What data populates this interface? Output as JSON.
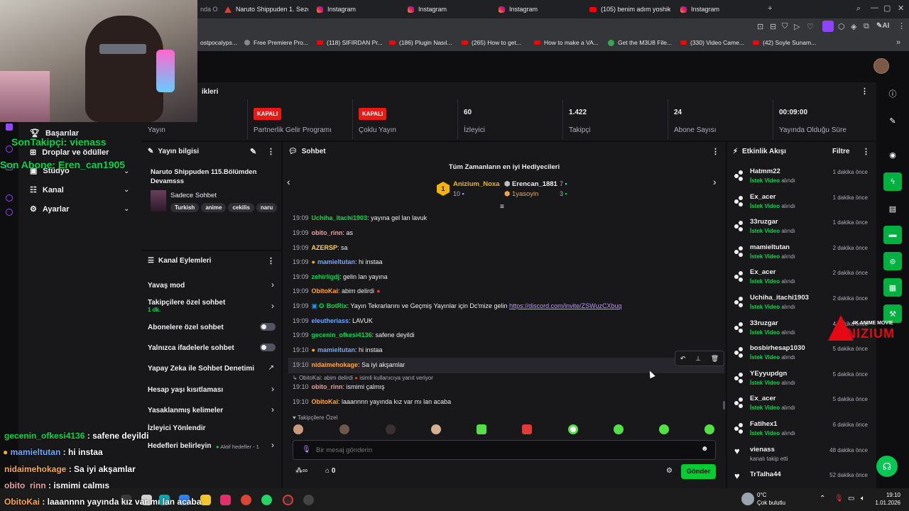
{
  "browser": {
    "tabs": [
      {
        "label": "Naruto Shippuden 1. Sezo",
        "icon": "naruto-icon"
      },
      {
        "label": "Instagram",
        "icon": "instagram-icon"
      },
      {
        "label": "Instagram",
        "icon": "instagram-icon"
      },
      {
        "label": "Instagram",
        "icon": "instagram-icon"
      },
      {
        "label": "(105) benim adım yoshikag",
        "icon": "youtube-icon"
      },
      {
        "label": "Instagram",
        "icon": "instagram-icon"
      }
    ],
    "partial_tab_label": "nda O",
    "bookmarks": [
      "ostpocalyps...",
      "Free Premiere Pro...",
      "(118) SIFIRDAN Pr...",
      "(186) Plugin Nasıl...",
      "(265) How to get...",
      "How to make a VA...",
      "Get the M3U8 File...",
      "(330) Video Came...",
      "(42) Soyle Sunam..."
    ],
    "ai_label": "AI"
  },
  "dashboard": {
    "section_title": "ikleri",
    "stats": [
      {
        "value": "",
        "label": "Yayın",
        "badge": ""
      },
      {
        "value": "",
        "label": "Partnerlik Gelir Programı",
        "badge": "KAPALI"
      },
      {
        "value": "",
        "label": "Çoklu Yayın",
        "badge": "KAPALI"
      },
      {
        "value": "60",
        "label": "İzleyici",
        "badge": ""
      },
      {
        "value": "1.422",
        "label": "Takipçi",
        "badge": ""
      },
      {
        "value": "24",
        "label": "Abone Sayısı",
        "badge": ""
      },
      {
        "value": "00:09:00",
        "label": "Yayında Olduğu Süre",
        "badge": ""
      }
    ]
  },
  "leftnav": {
    "items": [
      {
        "label": "Başarılar",
        "icon": "trophy-icon"
      },
      {
        "label": "Droplar ve ödüller",
        "icon": "gift-icon"
      },
      {
        "label": "Stüdyo",
        "icon": "studio-icon"
      },
      {
        "label": "Kanal",
        "icon": "channel-icon"
      },
      {
        "label": "Ayarlar",
        "icon": "gear-icon"
      }
    ]
  },
  "stream_info": {
    "title": "Yayın bilgisi",
    "stream_title": "Naruto Shippuden 115.Bölümden Devamsss",
    "category": "Sadece Sohbet",
    "tags": [
      "Turkish",
      "anime",
      "cekilis",
      "naru"
    ]
  },
  "channel_actions": {
    "title": "Kanal Eylemleri",
    "items": [
      {
        "label": "Yavaş mod",
        "sub": "",
        "control": "arrow"
      },
      {
        "label": "Takipçilere özel sohbet",
        "sub": "1 dk.",
        "control": "arrow"
      },
      {
        "label": "Abonelere özel sohbet",
        "sub": "",
        "control": "toggle"
      },
      {
        "label": "Yalnızca ifadelerle sohbet",
        "sub": "",
        "control": "toggle"
      },
      {
        "label": "Yapay Zeka ile Sohbet Denetimi",
        "sub": "",
        "control": "external"
      },
      {
        "label": "Hesap yaşı kısıtlaması",
        "sub": "",
        "control": "arrow"
      },
      {
        "label": "Yasaklanmış kelimeler",
        "sub": "",
        "control": "arrow"
      },
      {
        "label": "İzleyici Yönlendir",
        "sub": "",
        "control": "none"
      },
      {
        "label": "Hedefleri belirleyin",
        "sub": "",
        "control": "arrow"
      }
    ],
    "goals_status": "Aktif hedefler - 1"
  },
  "chat": {
    "title": "Sohbet",
    "leaderboard": {
      "title": "Tüm Zamanların en iyi Hediyecileri",
      "first": {
        "name": "Anizium_Noxa",
        "value": "10"
      },
      "second": {
        "name": "Erencan_1881",
        "value": "7"
      },
      "third": {
        "name": "1yasoyin",
        "value": "3"
      }
    },
    "messages": [
      {
        "time": "19:09",
        "user": "Uchiha_itachi1903",
        "color": "#00d94a",
        "text": ": yayına gel lan lavuk"
      },
      {
        "time": "19:09",
        "user": "obito_rinn",
        "color": "#e8a0a0",
        "text": ": as"
      },
      {
        "time": "19:09",
        "user": "AZERSP",
        "color": "#ffce5c",
        "text": ": sa"
      },
      {
        "time": "19:09",
        "user": "mamieltutan",
        "color": "#6fa8ff",
        "text": ": hi instaa"
      },
      {
        "time": "19:09",
        "user": "zehirligdj",
        "color": "#00d94a",
        "text": ": gelin lan yayına"
      },
      {
        "time": "19:09",
        "user": "ObitoKai",
        "color": "#ffa640",
        "text": ": abim delirdi"
      },
      {
        "time": "19:09",
        "user": "BotRix",
        "color": "#00d94a",
        "text": ": Yayın Tekrarlarını ve Geçmiş Yayınlar için Dc'mize gelin ",
        "link": "https://discord.com/invite/ZSWuzCXbuq"
      },
      {
        "time": "19:09",
        "user": "eleutheriass",
        "color": "#6fa8ff",
        "text": ": LAVUK"
      },
      {
        "time": "19:09",
        "user": "gecenin_ofkesi4136",
        "color": "#00d94a",
        "text": ": safene deyildi"
      },
      {
        "time": "19:10",
        "user": "mamieltutan",
        "color": "#6fa8ff",
        "text": ": hi instaa"
      },
      {
        "time": "19:10",
        "user": "nidaimehokage",
        "color": "#ffa640",
        "text": ": Sa iyi akşamlar"
      },
      {
        "time": "19:10",
        "user": "obito_rinn",
        "color": "#e8a0a0",
        "text": ": ismimi çalmış"
      },
      {
        "time": "19:10",
        "user": "ObitoKai",
        "color": "#ffa640",
        "text": ": laaannnn yayında kız var mı lan acaba"
      }
    ],
    "reply_ref": "ObitoKai: abim delirdi",
    "reply_note": "isimli kullanıcıya yanıt veriyor",
    "followers_only": "Takipçilere Özel",
    "input_placeholder": "Bir mesaj gönderin",
    "points": "0",
    "send_label": "Gönder"
  },
  "activity": {
    "title": "Etkinlik Akışı",
    "filter": "Filtre",
    "items": [
      {
        "name": "Hatmm22",
        "event": "İstek Video",
        "suffix": "alındı",
        "time": "1 dakika önce",
        "type": "video"
      },
      {
        "name": "Ex_acer",
        "event": "İstek Video",
        "suffix": "alındı",
        "time": "1 dakika önce",
        "type": "video"
      },
      {
        "name": "33ruzgar",
        "event": "İstek Video",
        "suffix": "alındı",
        "time": "1 dakika önce",
        "type": "video"
      },
      {
        "name": "mamieltutan",
        "event": "İstek Video",
        "suffix": "alındı",
        "time": "2 dakika önce",
        "type": "video"
      },
      {
        "name": "Ex_acer",
        "event": "İstek Video",
        "suffix": "alındı",
        "time": "2 dakika önce",
        "type": "video"
      },
      {
        "name": "Uchiha_itachi1903",
        "event": "İstek Video",
        "suffix": "alındı",
        "time": "2 dakika önce",
        "type": "video"
      },
      {
        "name": "33ruzgar",
        "event": "İstek Video",
        "suffix": "alındı",
        "time": "4 dakika önce",
        "type": "video"
      },
      {
        "name": "bosbirhesap1030",
        "event": "İstek Video",
        "suffix": "alındı",
        "time": "5 dakika önce",
        "type": "video"
      },
      {
        "name": "YEyyupdgn",
        "event": "İstek Video",
        "suffix": "alındı",
        "time": "5 dakika önce",
        "type": "video"
      },
      {
        "name": "Ex_acer",
        "event": "İstek Video",
        "suffix": "alındı",
        "time": "5 dakika önce",
        "type": "video"
      },
      {
        "name": "Fatihex1",
        "event": "İstek Video",
        "suffix": "alındı",
        "time": "6 dakika önce",
        "type": "video"
      },
      {
        "name": "vienass",
        "event": "",
        "suffix": "kanalı takip etti",
        "time": "48 dakika önce",
        "type": "follow"
      },
      {
        "name": "TrTalha44",
        "event": "",
        "suffix": "",
        "time": "52 dakika önce",
        "type": "follow"
      }
    ]
  },
  "overlay": {
    "last_follower": "SonTakipçi: vienass",
    "last_sub": "Son Abone: Eren_can1905",
    "chat": [
      {
        "user": "gecenin_ofkesi4136",
        "text": " : safene deyildi",
        "color": "#00d94a"
      },
      {
        "user": "mamieltutan",
        "text": " : hi instaa",
        "color": "#6fa8ff"
      },
      {
        "user": "nidaimehokage",
        "text": " : Sa iyi akşamlar",
        "color": "#ffa640"
      },
      {
        "user": "obito_rinn",
        "text": " : ismimi çalmış",
        "color": "#e8a0a0"
      },
      {
        "user": "ObitoKai",
        "text": " : laaannnn yayında kız var mı lan acaba",
        "color": "#ffa640"
      }
    ],
    "logo_sub": "4K ANIME MOVIE",
    "logo_main": "ANIZIUM"
  },
  "taskbar": {
    "weather_temp": "0°C",
    "weather_desc": "Çok bulutlu",
    "time": "19:10",
    "date": "1.01.2026"
  },
  "colors": {
    "accent": "#00cc33",
    "brand_purple": "#9147ff",
    "kapali": "#e91916"
  }
}
